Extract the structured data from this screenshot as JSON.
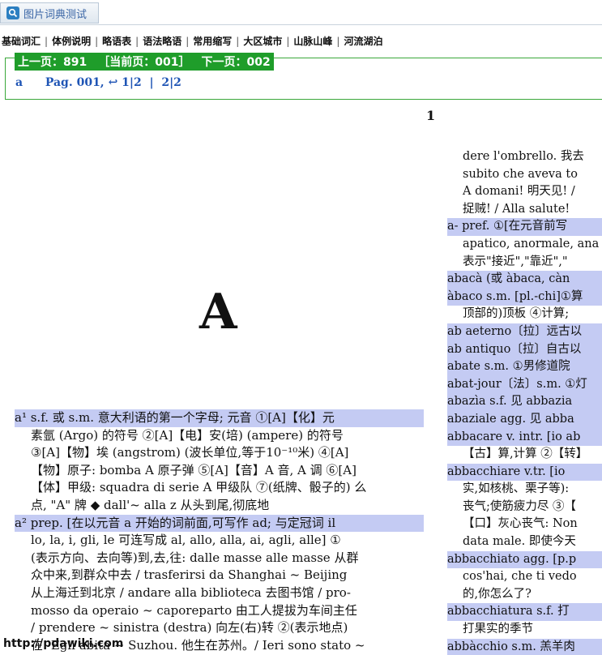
{
  "window": {
    "title": "图片词典测试"
  },
  "nav": {
    "items": [
      "基础词汇",
      "体例说明",
      "略语表",
      "语法略语",
      "常用缩写",
      "大区城市",
      "山脉山峰",
      "河流湖泊"
    ]
  },
  "pager": {
    "prev": "上一页：891",
    "current": "［当前页：001］",
    "next": "下一页：002"
  },
  "entry_line": {
    "word": "a",
    "pag": "Pag. 001,",
    "undo_icon": "undo-arrow-icon",
    "link1": "1|2",
    "divider": "|",
    "link2": "2|2"
  },
  "scan": {
    "page_number": "1",
    "big_letter": "A",
    "left_lines": [
      "a¹ s.f. 或 s.m. 意大利语的第一个字母; 元音 ①[A]【化】元",
      "素氩 (Argo) 的符号 ②[A]【电】安(培) (ampere) 的符号",
      "③[A]【物】埃 (angstrom) (波长单位,等于10⁻¹⁰米) ④[A]",
      "【物】原子: bomba A 原子弹 ⑤[A]【音】A 音, A 调 ⑥[A]",
      "【体】甲级: squadra di serie A 甲级队 ⑦(纸牌、骰子的) 么",
      "点, \"A\" 牌 ◆ dall'~ alla z 从头到尾,彻底地",
      "a² prep. [在以元音 a 开始的词前面,可写作 ad; 与定冠词 il",
      "lo, la, i, gli, le 可连写成 al, allo, alla, ai, agli, alle] ①",
      "(表示方向、去向等)到,去,往: dalle masse alle masse 从群",
      "众中来,到群众中去 / trasferirsi da Shanghai ~ Beijing",
      "从上海迁到北京 / andare alla biblioteca 去图书馆 / pro-",
      "mosso da operaio ~ caporeparto 由工人提拔为车间主任",
      "/ prendere ~ sinistra (destra) 向左(右)转 ②(表示地点)",
      "在: Egli abita ~ Suzhou. 他生在苏州。/ Ieri sono stato ~"
    ],
    "right_lines": [
      "dere l'ombrello. 我去",
      "subito che aveva to",
      "A domani! 明天见! /",
      "捉贼! / Alla salute!",
      "a- pref. ①[在元音前写",
      "apatico, anormale, ana",
      "表示\"接近\",\"靠近\",\"",
      "abacà (或 àbaca, càn",
      "àbaco s.m. [pl.-chi]①算",
      "顶部的)顶板 ④计算;",
      "ab aeterno〔拉〕远古以",
      "ab antiquo〔拉〕自古以",
      "abate s.m. ①男修道院",
      "abat-jour〔法〕s.m. ①灯",
      "abazìa s.f. 见 abbazia",
      "abaziale agg. 见 abba",
      "abbacare v. intr. [io ab",
      "【古】算,计算 ②【转】",
      "abbacchiare v.tr. [io",
      "实,如核桃、栗子等):",
      "丧气;使筋疲力尽 ③【",
      "【口】灰心丧气: Non",
      "data male. 即使今天",
      "abbacchiato agg. [p.p",
      "cos'hai, che ti vedo",
      "的,你怎么了?",
      "abbacchiatura s.f. 打",
      "打果实的季节",
      "abbàcchio s.m. 羔羊肉"
    ],
    "watermark": "http://pdawiki.com"
  },
  "colors": {
    "pager_green": "#1f9d2a",
    "link_blue": "#1f55b5",
    "highlight": "#c4cbf3"
  }
}
